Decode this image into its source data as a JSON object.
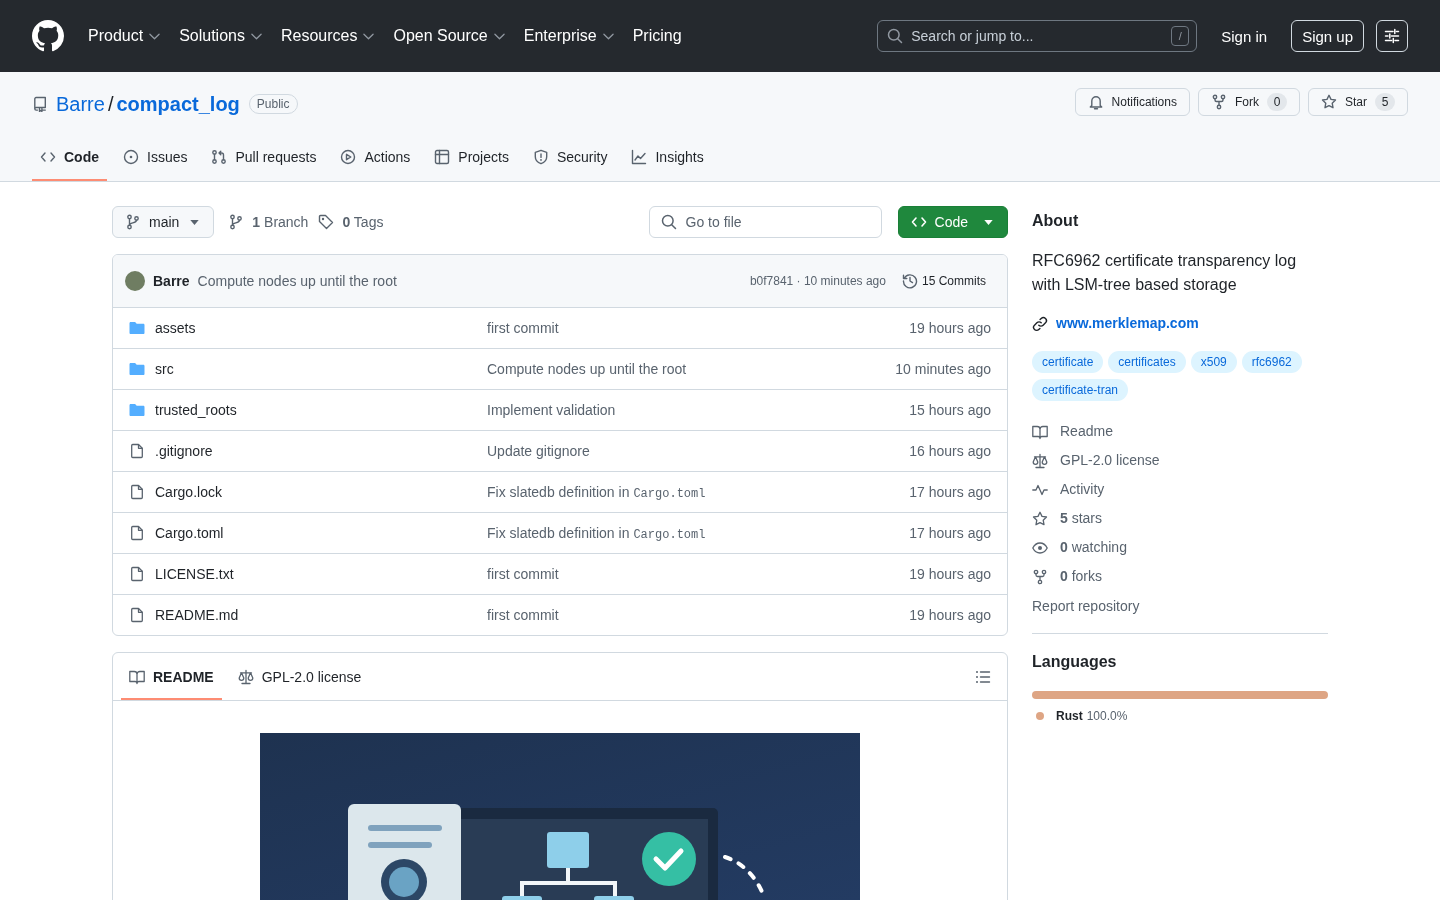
{
  "header": {
    "nav": [
      {
        "label": "Product",
        "dropdown": true
      },
      {
        "label": "Solutions",
        "dropdown": true
      },
      {
        "label": "Resources",
        "dropdown": true
      },
      {
        "label": "Open Source",
        "dropdown": true
      },
      {
        "label": "Enterprise",
        "dropdown": true
      },
      {
        "label": "Pricing",
        "dropdown": false
      }
    ],
    "search": {
      "placeholder": "Search or jump to...",
      "shortcut": "/"
    },
    "sign_in": "Sign in",
    "sign_up": "Sign up"
  },
  "repo": {
    "owner": "Barre",
    "separator": "/",
    "name": "compact_log",
    "visibility": "Public",
    "actions": [
      {
        "kind": "notifications",
        "label": "Notifications"
      },
      {
        "kind": "fork",
        "label": "Fork",
        "count": "0"
      },
      {
        "kind": "star",
        "label": "Star",
        "count": "5"
      }
    ]
  },
  "tabs": [
    {
      "kind": "code",
      "label": "Code",
      "selected": true
    },
    {
      "kind": "issues",
      "label": "Issues",
      "selected": false
    },
    {
      "kind": "pulls",
      "label": "Pull requests",
      "selected": false
    },
    {
      "kind": "actions",
      "label": "Actions",
      "selected": false
    },
    {
      "kind": "projects",
      "label": "Projects",
      "selected": false
    },
    {
      "kind": "security",
      "label": "Security",
      "selected": false
    },
    {
      "kind": "insights",
      "label": "Insights",
      "selected": false
    }
  ],
  "branch_bar": {
    "branch": "main",
    "branches": "**1** Branch",
    "tags": "**0** Tags",
    "file_search": {
      "placeholder": "Go to file"
    },
    "code_button": "Code"
  },
  "latest_commit": {
    "author": "Barre",
    "message": "Compute nodes up until the root",
    "meta": "b0f7841 · 10 minutes ago",
    "commits": "15 Commits"
  },
  "files": [
    {
      "kind": "folder",
      "name": "assets",
      "message": "first commit",
      "time": "19 hours ago"
    },
    {
      "kind": "folder",
      "name": "src",
      "message": "Compute nodes up until the root",
      "time": "10 minutes ago"
    },
    {
      "kind": "folder",
      "name": "trusted_roots",
      "message": "Implement validation",
      "time": "15 hours ago"
    },
    {
      "kind": "file",
      "name": ".gitignore",
      "message": "Update gitignore",
      "time": "16 hours ago"
    },
    {
      "kind": "file",
      "name": "Cargo.lock",
      "message": "Fix slatedb definition in",
      "message_code": "Cargo.toml",
      "time": "17 hours ago"
    },
    {
      "kind": "file",
      "name": "Cargo.toml",
      "message": "Fix slatedb definition in",
      "message_code": "Cargo.toml",
      "time": "17 hours ago"
    },
    {
      "kind": "file",
      "name": "LICENSE.txt",
      "message": "first commit",
      "time": "19 hours ago"
    },
    {
      "kind": "file",
      "name": "README.md",
      "message": "first commit",
      "time": "19 hours ago"
    }
  ],
  "readme": {
    "tabs": [
      {
        "kind": "readme",
        "label": "README",
        "selected": true
      },
      {
        "kind": "license",
        "label": "GPL-2.0 license",
        "selected": false
      }
    ]
  },
  "about": {
    "title": "About",
    "description": "RFC6962 certificate transparency log with LSM-tree based storage",
    "website": "www.merklemap.com",
    "topics": [
      "certificate",
      "certificates",
      "x509",
      "rfc6962",
      "certificate-tran"
    ],
    "links": [
      {
        "kind": "readme",
        "label": "Readme"
      },
      {
        "kind": "license",
        "label": "GPL-2.0 license"
      },
      {
        "kind": "activity",
        "label": "Activity"
      },
      {
        "kind": "stars",
        "label": "**5** stars"
      },
      {
        "kind": "watching",
        "label": "**0** watching"
      },
      {
        "kind": "forks",
        "label": "**0** forks"
      }
    ],
    "report": "Report repository"
  },
  "languages": {
    "title": "Languages",
    "items": [
      {
        "name": "Rust",
        "percent": "100.0%",
        "color": "#dea584"
      }
    ]
  }
}
